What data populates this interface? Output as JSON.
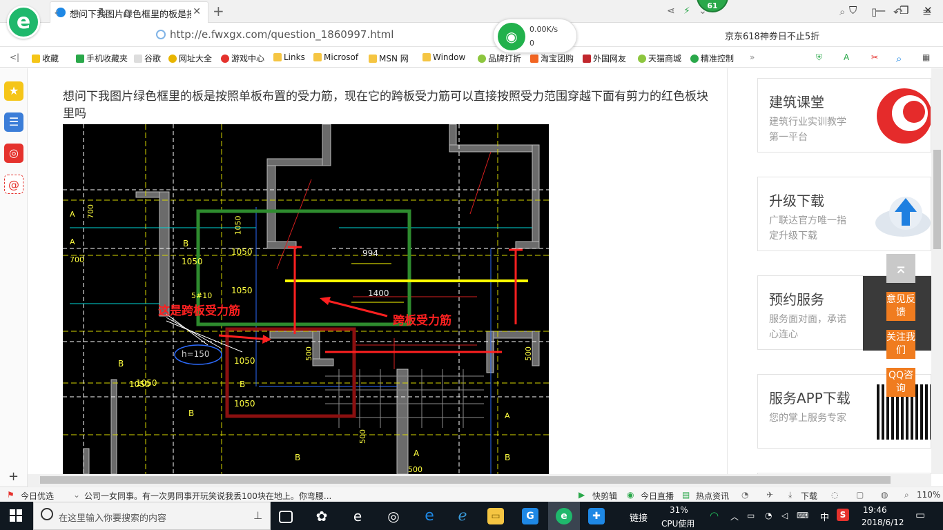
{
  "browser": {
    "tab_title": "想问下我图片绿色框里的板是按照单板布置的受力筋，现在它的跨板受力筋可以直接按照受力范围穿越下面有剪力的红色板块里吗",
    "badge_count": "61",
    "url": "http://e.fwxgx.com/question_1860997.html",
    "net_speed": "0.00K/s",
    "net_count": "0",
    "promo": "京东618神券日不止5折"
  },
  "bookmarks": [
    "收藏",
    "手机收藏夹",
    "谷歌",
    "网址大全",
    "游戏中心",
    "Links",
    "Microsof",
    "MSN 网",
    "Window",
    "品牌打折",
    "淘宝团购",
    "外国网友",
    "天猫商城",
    "精准控制"
  ],
  "question": "想问下我图片绿色框里的板是按照单板布置的受力筋，现在它的跨板受力筋可以直接按照受力范围穿越下面有剪力的红色板块里吗",
  "cad": {
    "label_left": "这是跨板受力筋",
    "label_right": "跨板受力筋",
    "dim_994": "994",
    "dim_1400": "1400",
    "h150": "h=150",
    "dims": [
      "700",
      "1050",
      "1050",
      "1050",
      "1050",
      "1050",
      "5#10",
      "1050",
      "1050",
      "B",
      "B",
      "B",
      "A",
      "A",
      "A",
      "500",
      "500",
      "500",
      "1050",
      "700",
      "500",
      "B",
      "B",
      "A",
      "B"
    ]
  },
  "sidebar_cards": [
    {
      "title": "建筑课堂",
      "desc": "建筑行业实训教学第一平台"
    },
    {
      "title": "升级下载",
      "desc": "广联达官方唯一指定升级下载"
    },
    {
      "title": "预约服务",
      "desc": "服务面对面，承诺心连心"
    },
    {
      "title": "服务APP下载",
      "desc": "您的掌上服务专家"
    }
  ],
  "float_buttons": [
    "意见反馈",
    "关注我们",
    "QQ咨询"
  ],
  "status": {
    "today": "今日优选",
    "news": "公司一女同事。有一次男同事开玩笑说我丢100块在地上。你弯腰...",
    "kuaijian": "快剪辑",
    "live": "今日直播",
    "hot": "热点资讯",
    "download": "下载",
    "zoom": "110%"
  },
  "taskbar": {
    "search_placeholder": "在这里输入你要搜索的内容",
    "link": "链接",
    "cpu_pct": "31%",
    "cpu_label": "CPU使用",
    "ime": "中",
    "time": "19:46",
    "date": "2018/6/12"
  }
}
